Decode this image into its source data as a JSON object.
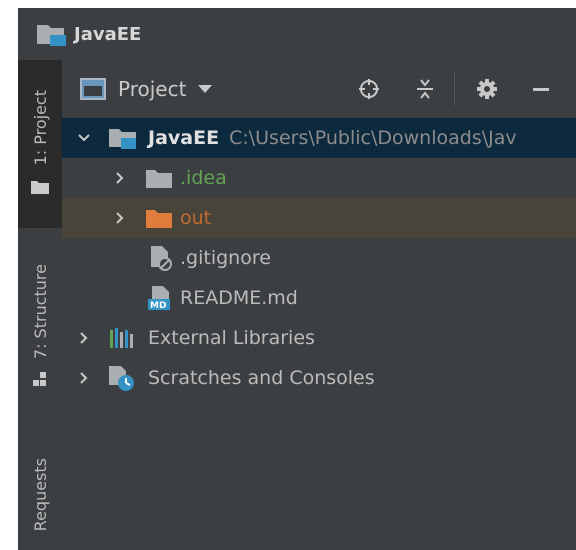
{
  "window": {
    "title": "JavaEE"
  },
  "tool_strip": {
    "items": [
      {
        "label": "1: Project",
        "icon": "folder-icon",
        "active": true
      },
      {
        "label": "7: Structure",
        "icon": "structure-icon",
        "active": false
      },
      {
        "label": "Requests",
        "icon": "",
        "active": false
      }
    ]
  },
  "panel": {
    "view_label": "Project",
    "tools": [
      "locate-icon",
      "collapse-all-icon",
      "gear-icon",
      "hide-icon"
    ]
  },
  "tree": {
    "root": {
      "name": "JavaEE",
      "path": "C:\\Users\\Public\\Downloads\\Jav"
    },
    "nodes": [
      {
        "name": ".idea",
        "color": "#62a356"
      },
      {
        "name": "out",
        "color": "#c06a33"
      },
      {
        "name": ".gitignore",
        "color": "#bbbbbb"
      },
      {
        "name": "README.md",
        "color": "#bbbbbb"
      },
      {
        "name": "External Libraries",
        "color": "#bbbbbb"
      },
      {
        "name": "Scratches and Consoles",
        "color": "#bbbbbb"
      }
    ]
  },
  "colors": {
    "panel_bg": "#3c3f41",
    "selection_bg": "#0d293e",
    "excluded_bg": "#49443a",
    "folder_orange": "#e07c3c",
    "folder_gray": "#a9aeb3",
    "accent_blue": "#3592c4"
  }
}
